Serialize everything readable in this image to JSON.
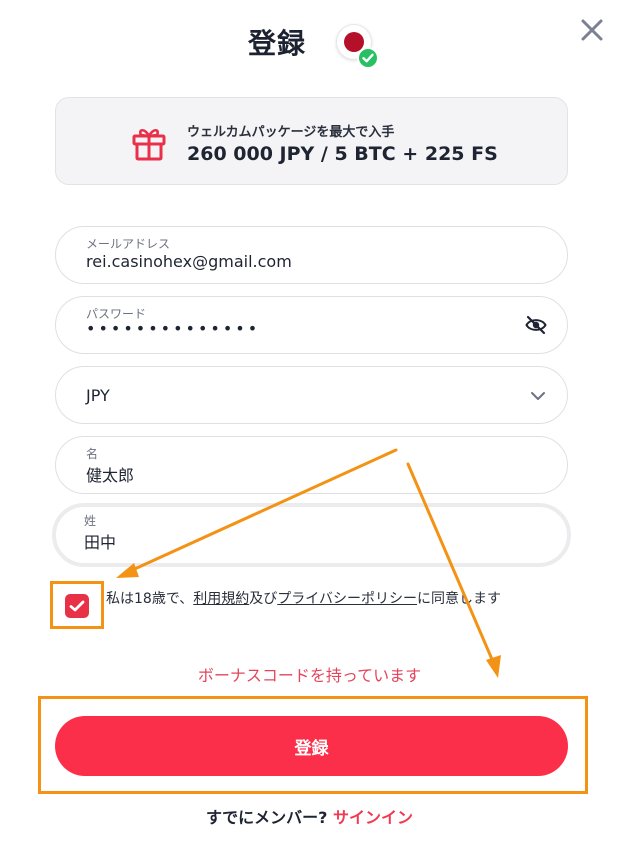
{
  "header": {
    "title": "登録",
    "close_icon": "close-icon",
    "flag_icon": "japan-flag-icon",
    "verified_icon": "check-circle-icon"
  },
  "promo": {
    "icon": "gift-icon",
    "subtitle": "ウェルカムパッケージを最大で入手",
    "amount": "260 000 JPY / 5 BTC + 225 FS"
  },
  "form": {
    "email": {
      "label": "メールアドレス",
      "value": "rei.casinohex@gmail.com"
    },
    "password": {
      "label": "パスワード",
      "value": "••••••••••••••",
      "toggle_icon": "eye-off-icon"
    },
    "currency": {
      "value": "JPY",
      "dropdown_icon": "chevron-down-icon"
    },
    "first_name": {
      "label": "名",
      "value": "健太郎"
    },
    "last_name": {
      "label": "姓",
      "value": "田中"
    }
  },
  "agreement": {
    "checked": true,
    "text_pre": "私は18歳で、",
    "terms_link": "利用規約",
    "text_mid": "及び",
    "privacy_link": "プライバシーポリシー",
    "text_post": "に同意します"
  },
  "bonus_link": "ボーナスコードを持っています",
  "submit_label": "登録",
  "footer": {
    "member_text": "すでにメンバー?",
    "signin_link": "サインイン"
  },
  "colors": {
    "accent": "#fc2f4b",
    "annotation": "#f39214",
    "bonus_text": "#e5455c"
  }
}
